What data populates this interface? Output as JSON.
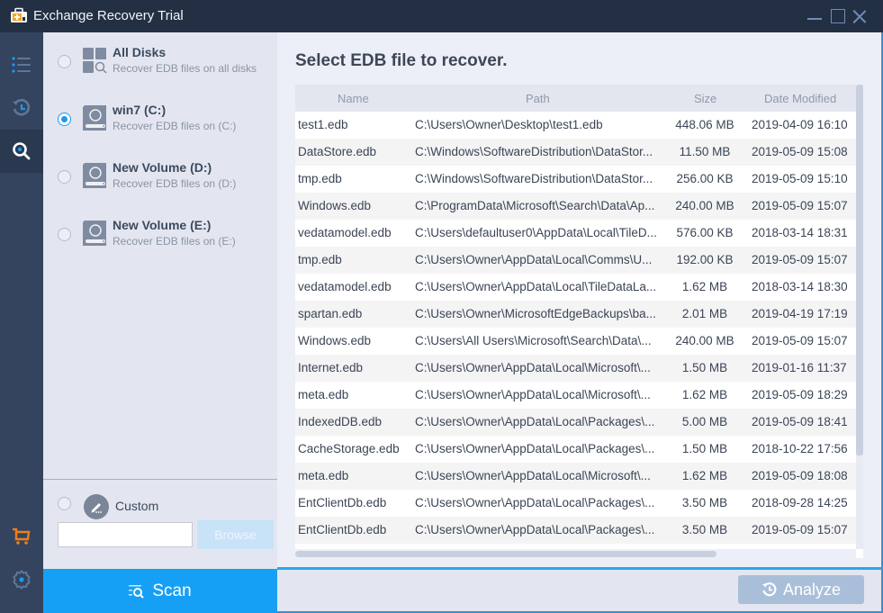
{
  "window": {
    "title": "Exchange Recovery Trial",
    "controls": [
      "minimize",
      "maximize",
      "close"
    ]
  },
  "rail": {
    "items": [
      {
        "icon": "list-icon",
        "label": "menu"
      },
      {
        "icon": "history-icon",
        "label": "history"
      },
      {
        "icon": "search-icon",
        "label": "search",
        "active": true
      },
      {
        "icon": "cart-icon",
        "label": "purchase"
      },
      {
        "icon": "gear-icon",
        "label": "settings"
      }
    ]
  },
  "disks": [
    {
      "title": "All Disks",
      "subtitle": "Recover EDB files on all disks",
      "icon": "all-disks-icon",
      "selected": false
    },
    {
      "title": "win7 (C:)",
      "subtitle": "Recover EDB files on (C:)",
      "icon": "hard-drive-icon",
      "selected": true
    },
    {
      "title": "New Volume (D:)",
      "subtitle": "Recover EDB files on (D:)",
      "icon": "hard-drive-icon",
      "selected": false
    },
    {
      "title": "New Volume (E:)",
      "subtitle": "Recover EDB files on (E:)",
      "icon": "hard-drive-icon",
      "selected": false
    }
  ],
  "custom": {
    "label": "Custom",
    "input_value": "",
    "browse_label": "Browse"
  },
  "scan_label": "Scan",
  "main": {
    "title": "Select EDB file to recover.",
    "columns": {
      "name": "Name",
      "path": "Path",
      "size": "Size",
      "date": "Date Modified"
    },
    "files": [
      {
        "name": "test1.edb",
        "path": "C:\\Users\\Owner\\Desktop\\test1.edb",
        "size": "448.06 MB",
        "date": "2019-04-09 16:10"
      },
      {
        "name": "DataStore.edb",
        "path": "C:\\Windows\\SoftwareDistribution\\DataStor...",
        "size": "11.50 MB",
        "date": "2019-05-09 15:08"
      },
      {
        "name": "tmp.edb",
        "path": "C:\\Windows\\SoftwareDistribution\\DataStor...",
        "size": "256.00 KB",
        "date": "2019-05-09 15:10"
      },
      {
        "name": "Windows.edb",
        "path": "C:\\ProgramData\\Microsoft\\Search\\Data\\Ap...",
        "size": "240.00 MB",
        "date": "2019-05-09 15:07"
      },
      {
        "name": "vedatamodel.edb",
        "path": "C:\\Users\\defaultuser0\\AppData\\Local\\TileD...",
        "size": "576.00 KB",
        "date": "2018-03-14 18:31"
      },
      {
        "name": "tmp.edb",
        "path": "C:\\Users\\Owner\\AppData\\Local\\Comms\\U...",
        "size": "192.00 KB",
        "date": "2019-05-09 15:07"
      },
      {
        "name": "vedatamodel.edb",
        "path": "C:\\Users\\Owner\\AppData\\Local\\TileDataLa...",
        "size": "1.62 MB",
        "date": "2018-03-14 18:30"
      },
      {
        "name": "spartan.edb",
        "path": "C:\\Users\\Owner\\MicrosoftEdgeBackups\\ba...",
        "size": "2.01 MB",
        "date": "2019-04-19 17:19"
      },
      {
        "name": "Windows.edb",
        "path": "C:\\Users\\All Users\\Microsoft\\Search\\Data\\...",
        "size": "240.00 MB",
        "date": "2019-05-09 15:07"
      },
      {
        "name": "Internet.edb",
        "path": "C:\\Users\\Owner\\AppData\\Local\\Microsoft\\...",
        "size": "1.50 MB",
        "date": "2019-01-16 11:37"
      },
      {
        "name": "meta.edb",
        "path": "C:\\Users\\Owner\\AppData\\Local\\Microsoft\\...",
        "size": "1.62 MB",
        "date": "2019-05-09 18:29"
      },
      {
        "name": "IndexedDB.edb",
        "path": "C:\\Users\\Owner\\AppData\\Local\\Packages\\...",
        "size": "5.00 MB",
        "date": "2019-05-09 18:41"
      },
      {
        "name": "CacheStorage.edb",
        "path": "C:\\Users\\Owner\\AppData\\Local\\Packages\\...",
        "size": "1.50 MB",
        "date": "2018-10-22 17:56"
      },
      {
        "name": "meta.edb",
        "path": "C:\\Users\\Owner\\AppData\\Local\\Microsoft\\...",
        "size": "1.62 MB",
        "date": "2019-05-09 18:08"
      },
      {
        "name": "EntClientDb.edb",
        "path": "C:\\Users\\Owner\\AppData\\Local\\Packages\\...",
        "size": "3.50 MB",
        "date": "2018-09-28 14:25"
      },
      {
        "name": "EntClientDb.edb",
        "path": "C:\\Users\\Owner\\AppData\\Local\\Packages\\...",
        "size": "3.50 MB",
        "date": "2019-05-09 15:07"
      }
    ]
  },
  "analyze_label": "Analyze",
  "colors": {
    "accent": "#16a0f5",
    "titlebar": "#233044",
    "rail": "#34445e",
    "panel": "#e3e6f0",
    "cart": "#f07d1a",
    "analyze_disabled": "#a9bfd9"
  }
}
